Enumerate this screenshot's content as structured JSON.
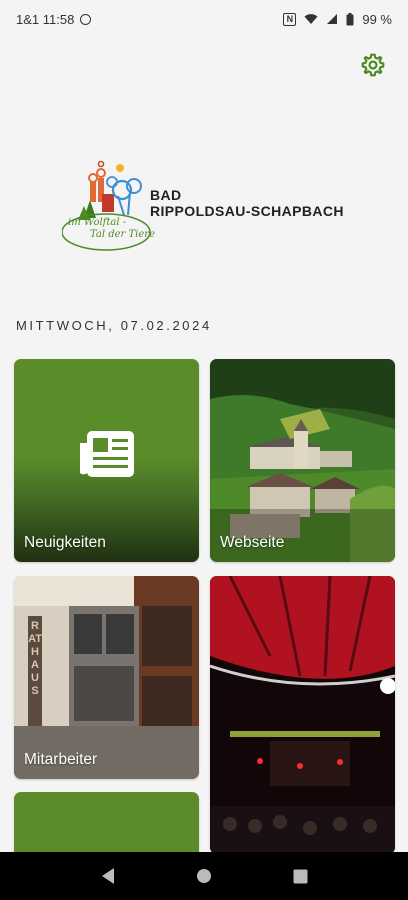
{
  "status": {
    "carrier_time": "1&1 11:58",
    "battery": "99 %"
  },
  "header": {
    "settings_icon": "gear-icon",
    "accent_color": "#4d8a23"
  },
  "brand": {
    "line1": "BAD",
    "line2": "RIPPOLDSAU-SCHAPBACH",
    "logo_script1": "im Wolftal -",
    "logo_script2": "Tal der Tiere"
  },
  "date": "MITTWOCH, 07.02.2024",
  "tiles": [
    {
      "label": "Neuigkeiten",
      "icon": "newspaper-icon"
    },
    {
      "label": "Webseite"
    },
    {
      "label": "Mitarbeiter",
      "sign": "RATHAUS"
    },
    {
      "label": ""
    },
    {
      "label": ""
    }
  ],
  "nav": {
    "back": "back-icon",
    "home": "home-icon",
    "recents": "recents-icon"
  }
}
